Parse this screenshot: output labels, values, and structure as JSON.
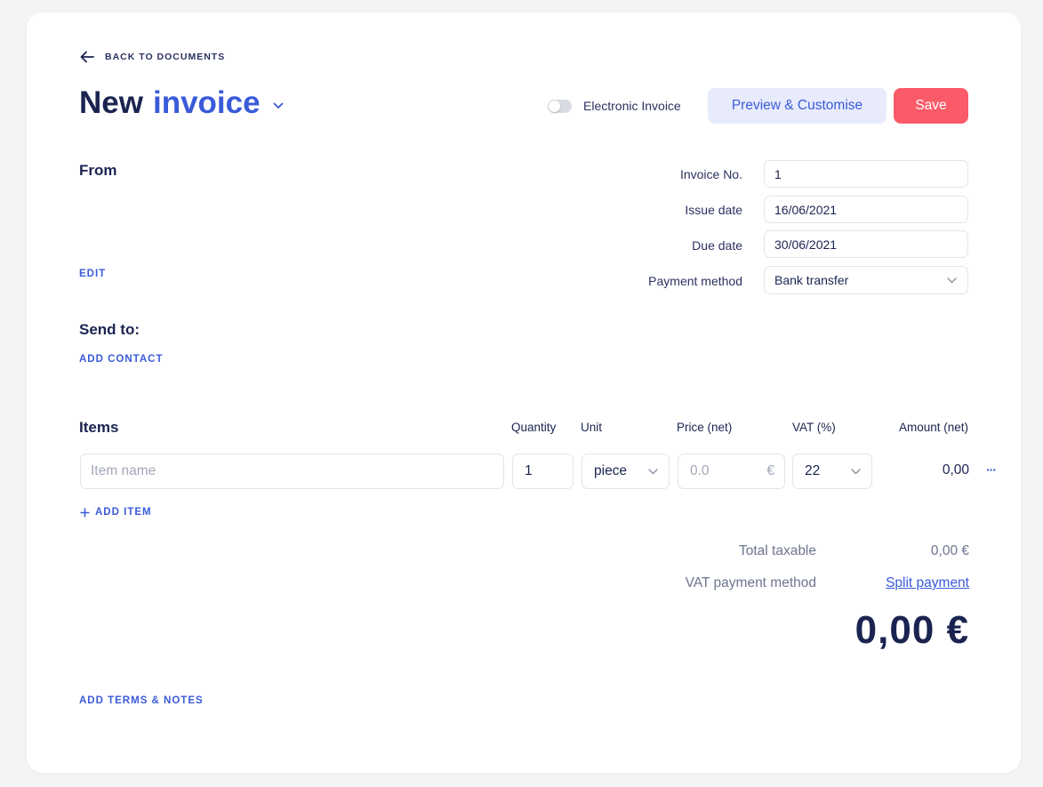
{
  "header": {
    "back_label": "BACK TO DOCUMENTS",
    "title_prefix": "New",
    "title_doc_type": "invoice",
    "electronic_invoice_label": "Electronic Invoice",
    "electronic_invoice_enabled": false,
    "preview_label": "Preview & Customise",
    "save_label": "Save"
  },
  "from": {
    "heading": "From",
    "edit_label": "EDIT"
  },
  "send_to": {
    "heading": "Send to:",
    "add_contact_label": "ADD CONTACT"
  },
  "meta": {
    "invoice_no": {
      "label": "Invoice No.",
      "value": "1"
    },
    "issue_date": {
      "label": "Issue date",
      "value": "16/06/2021"
    },
    "due_date": {
      "label": "Due date",
      "value": "30/06/2021"
    },
    "payment_method": {
      "label": "Payment method",
      "value": "Bank transfer"
    }
  },
  "items": {
    "heading": "Items",
    "columns": {
      "quantity": "Quantity",
      "unit": "Unit",
      "price": "Price (net)",
      "vat": "VAT (%)",
      "amount": "Amount (net)"
    },
    "rows": [
      {
        "name_placeholder": "Item name",
        "name": "",
        "quantity": "1",
        "unit": "piece",
        "price_placeholder": "0.0",
        "currency_symbol": "€",
        "vat": "22",
        "amount": "0,00",
        "more_label": "···"
      }
    ],
    "add_item_label": "ADD ITEM"
  },
  "totals": {
    "taxable_label": "Total taxable",
    "taxable_value": "0,00 €",
    "vat_method_label": "VAT payment method",
    "vat_method_value": "Split payment",
    "grand_total": "0,00 €"
  },
  "footer": {
    "terms_label": "ADD TERMS & NOTES"
  },
  "colors": {
    "brand_blue": "#3a5bd9",
    "navy": "#1b2450",
    "save_red": "#fb5a68",
    "preview_bg": "#e8ebfb"
  }
}
